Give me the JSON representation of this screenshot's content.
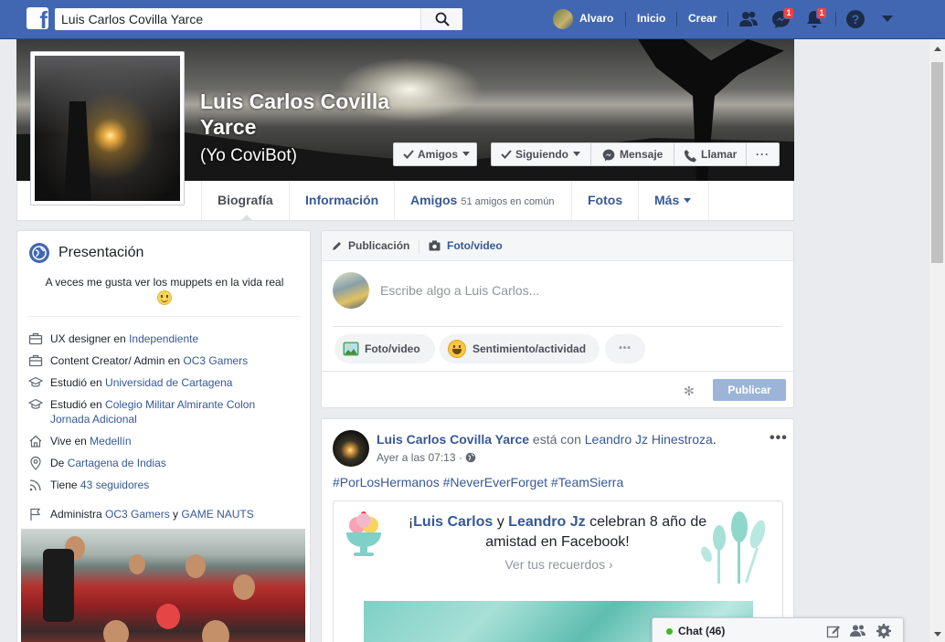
{
  "topbar": {
    "search_value": "Luis Carlos Covilla Yarce",
    "user_name": "Alvaro",
    "home_label": "Inicio",
    "create_label": "Crear",
    "messages_badge": "1",
    "notifications_badge": "1",
    "brand_color": "#4267b2"
  },
  "profile": {
    "name": "Luis Carlos Covilla Yarce",
    "nickname": "(Yo CoviBot)",
    "buttons": {
      "friends": "Amigos",
      "following": "Siguiendo",
      "message": "Mensaje",
      "call": "Llamar",
      "more": "···"
    }
  },
  "tabs": [
    {
      "label": "Biografía"
    },
    {
      "label": "Información"
    },
    {
      "label": "Amigos",
      "sub": "51 amigos en común"
    },
    {
      "label": "Fotos"
    },
    {
      "label": "Más"
    }
  ],
  "intro": {
    "title": "Presentación",
    "bio": "A veces me gusta ver los muppets en la vida real",
    "rows": [
      {
        "text": "UX designer en ",
        "link": "Independiente",
        "icon": "briefcase-icon"
      },
      {
        "text": "Content Creator/ Admin en ",
        "link": "OC3 Gamers",
        "icon": "briefcase-icon"
      },
      {
        "text": "Estudió en ",
        "link": "Universidad de Cartagena",
        "icon": "graduation-cap-icon"
      },
      {
        "text": "Estudió en ",
        "link": "Colegio Militar Almirante Colon Jornada Adicional",
        "icon": "graduation-cap-icon"
      },
      {
        "text": "Vive en ",
        "link": "Medellín",
        "icon": "home-icon"
      },
      {
        "text": "De ",
        "link": "Cartagena de Indias",
        "icon": "location-pin-icon"
      },
      {
        "text": "Tiene ",
        "link": "43 seguidores",
        "icon": "rss-icon"
      },
      {
        "text": "Administra ",
        "link": "OC3 Gamers",
        "mid": " y ",
        "link2": "GAME NAUTS",
        "icon": "flag-icon"
      }
    ]
  },
  "composer": {
    "tab_post": "Publicación",
    "tab_photo": "Foto/video",
    "placeholder": "Escribe algo a Luis Carlos...",
    "pill_photo": "Foto/video",
    "pill_feeling": "Sentimiento/actividad",
    "pill_more": "•••",
    "publish": "Publicar"
  },
  "post": {
    "author": "Luis Carlos Covilla Yarce",
    "with_text": " está con ",
    "with_name": "Leandro Jz Hinestroza",
    "with_end": ".",
    "time": "Ayer a las 07:13 · ",
    "hashtags": "#PorLosHermanos #NeverEverForget #TeamSierra",
    "memory": {
      "prefix": "¡",
      "name1": "Luis Carlos",
      "and": " y ",
      "name2": "Leandro Jz",
      "rest": " celebran 8 año de amistad en Facebook!",
      "link": "Ver tus recuerdos"
    }
  },
  "chat": {
    "label": "Chat (46)",
    "online_color": "#42b72a"
  }
}
